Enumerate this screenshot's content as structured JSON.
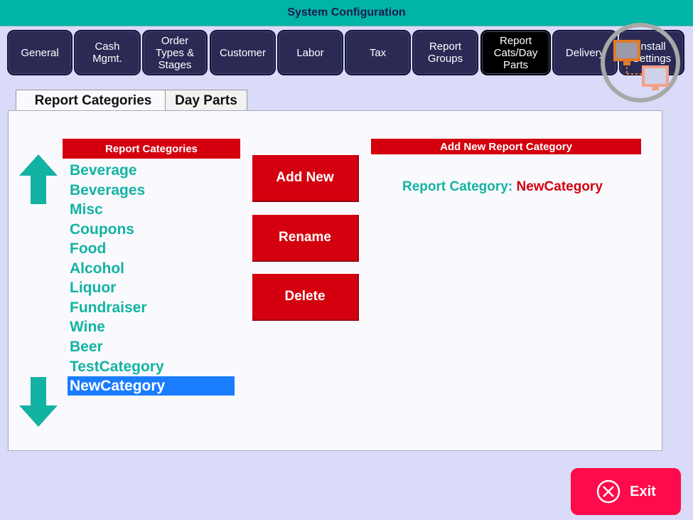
{
  "window": {
    "title": "System Configuration"
  },
  "tabs": [
    {
      "label": "General"
    },
    {
      "label": "Cash\nMgmt."
    },
    {
      "label": "Order\nTypes &\nStages"
    },
    {
      "label": "Customer"
    },
    {
      "label": "Labor"
    },
    {
      "label": "Tax"
    },
    {
      "label": "Report\nGroups"
    },
    {
      "label": "Report\nCats/Day\nParts",
      "active": true
    },
    {
      "label": "Delivery"
    },
    {
      "label": "Install\nSettings"
    }
  ],
  "subtabs": [
    {
      "label": "Report Categories",
      "active": true
    },
    {
      "label": "Day Parts"
    }
  ],
  "list": {
    "header": "Report Categories",
    "items": [
      "Beverage",
      "Beverages",
      "Misc",
      "Coupons",
      "Food",
      "Alcohol",
      "Liquor",
      "Fundraiser",
      "Wine",
      "Beer",
      "TestCategory",
      "NewCategory"
    ],
    "selected": "NewCategory"
  },
  "actions": {
    "add": "Add New",
    "rename": "Rename",
    "delete": "Delete"
  },
  "form": {
    "header": "Add New Report Category",
    "label": "Report Category:",
    "value": "NewCategory"
  },
  "exit_label": "Exit",
  "colors": {
    "teal": "#00b4a6",
    "red": "#d4000f",
    "selection": "#1a7cff",
    "exit": "#ff0a4a"
  }
}
